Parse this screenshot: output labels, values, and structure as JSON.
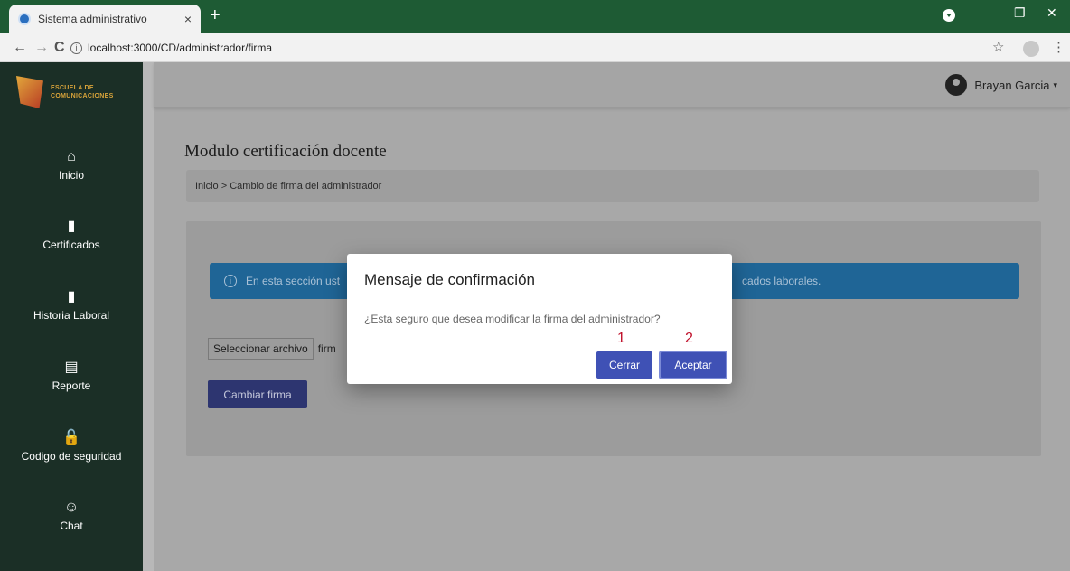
{
  "browser": {
    "tab_title": "Sistema administrativo",
    "tab_close": "×",
    "new_tab": "+",
    "url": "localhost:3000/CD/administrador/firma",
    "controls": {
      "minimize": "–",
      "restore": "❐",
      "close": "✕"
    },
    "icons": {
      "back": "←",
      "forward": "→",
      "reload": "C",
      "star": "☆",
      "menu": "⋮"
    }
  },
  "sidebar": {
    "logo_text": [
      "ESCUELA DE",
      "COMUNICACIONES"
    ],
    "items": [
      {
        "label": "Inicio",
        "icon": "home-icon",
        "glyph": "⌂"
      },
      {
        "label": "Certificados",
        "icon": "book-icon",
        "glyph": "▮"
      },
      {
        "label": "Historia Laboral",
        "icon": "notebook-icon",
        "glyph": "▮"
      },
      {
        "label": "Reporte",
        "icon": "report-icon",
        "glyph": "▤"
      },
      {
        "label": "Codigo de seguridad",
        "icon": "lock-icon",
        "glyph": "🔓"
      },
      {
        "label": "Chat",
        "icon": "chat-person-icon",
        "glyph": "☺"
      }
    ]
  },
  "header": {
    "user_name": "Brayan Garcia",
    "caret": "▾"
  },
  "main": {
    "title": "Modulo certificación docente",
    "breadcrumb": "Inicio > Cambio de firma del administrador",
    "alert_visible_start": "En esta sección ust",
    "alert_visible_end": "cados laborales.",
    "file_button": "Seleccionar archivo",
    "file_name": "firm",
    "change_button": "Cambiar firma"
  },
  "modal": {
    "title": "Mensaje de confirmación",
    "message": "¿Esta seguro que desea modificar la firma del administrador?",
    "annotation_1": "1",
    "annotation_2": "2",
    "cancel_label": "Cerrar",
    "accept_label": "Aceptar"
  },
  "colors": {
    "chrome": "#1e5b34",
    "sidebar": "#1b2f26",
    "primary_button": "#3f51b5",
    "alert": "#1f6596",
    "annotation": "#c0102a"
  }
}
